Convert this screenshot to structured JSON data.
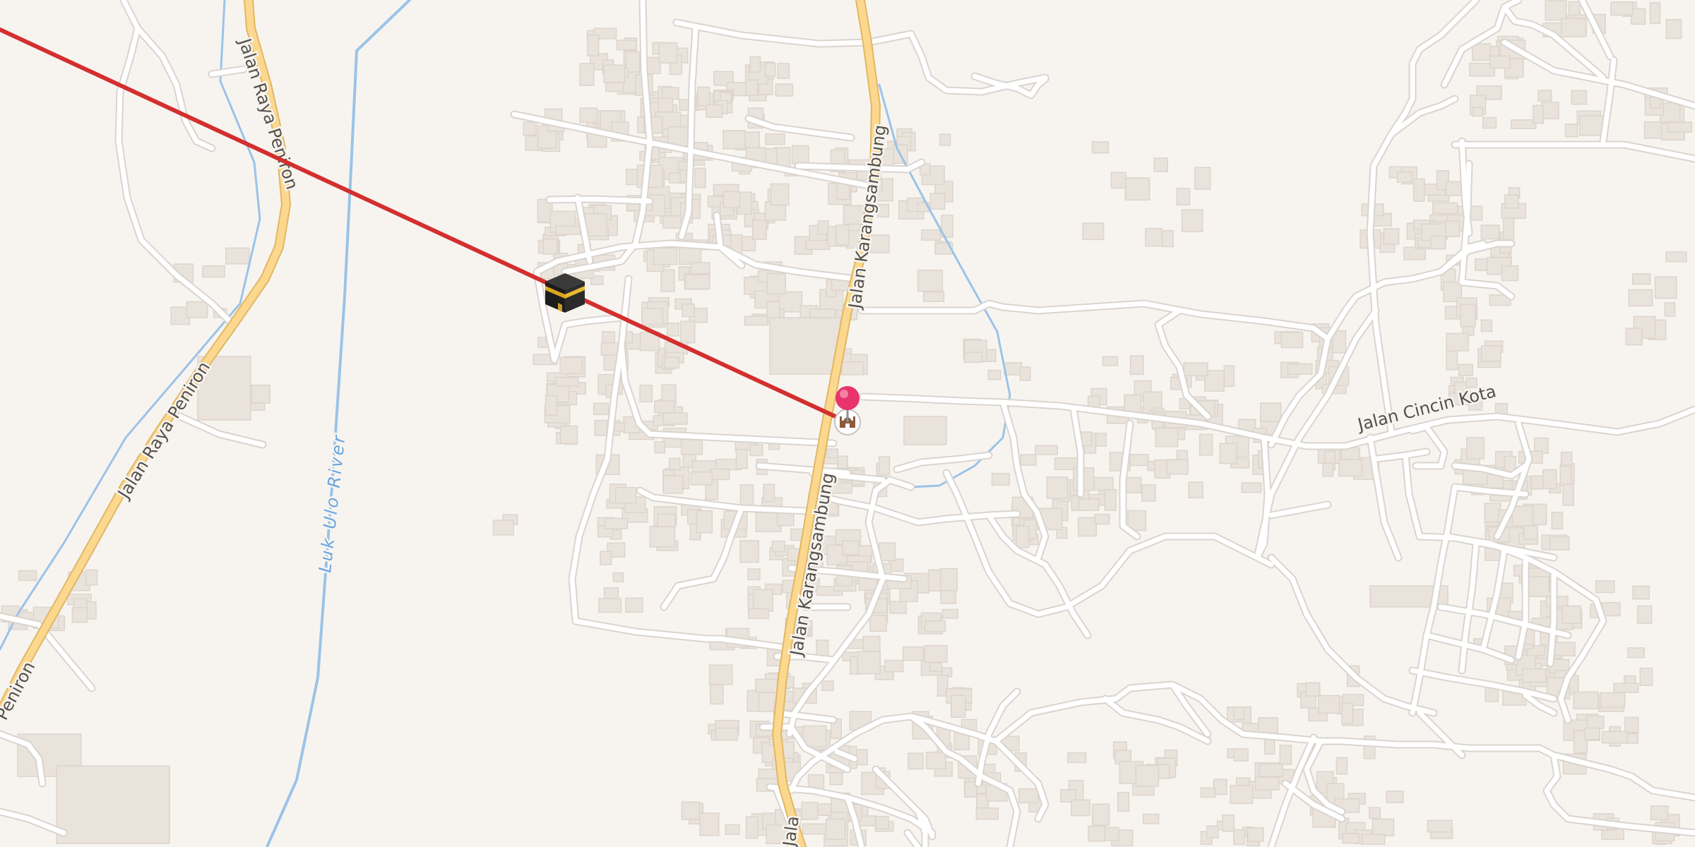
{
  "map": {
    "roads": {
      "raya_peniron_upper": "Jalan Raya Peniron",
      "raya_peniron_lower": "Jalan Raya Peniron",
      "raya_peniron_edge": "Peniron",
      "karangsambung_upper": "Jalan Karangsambung",
      "karangsambung_mid": "Jalan Karangsambung",
      "karangsambung_lower": "Jalan Karangsambung",
      "karangsambung_bottom": "Jala",
      "cincin_kota": "Jalan Cincin Kota"
    },
    "river": "Luk Ulo River",
    "markers": {
      "kaaba": "kaaba-icon",
      "pin": "location-pin-icon",
      "mosque": "mosque-icon"
    },
    "colors": {
      "qibla_line": "#d32f2f",
      "pin": "#e8336d",
      "primary_road": "#fcd88f",
      "river": "#9cc3e8",
      "background": "#f7f4f0"
    }
  }
}
